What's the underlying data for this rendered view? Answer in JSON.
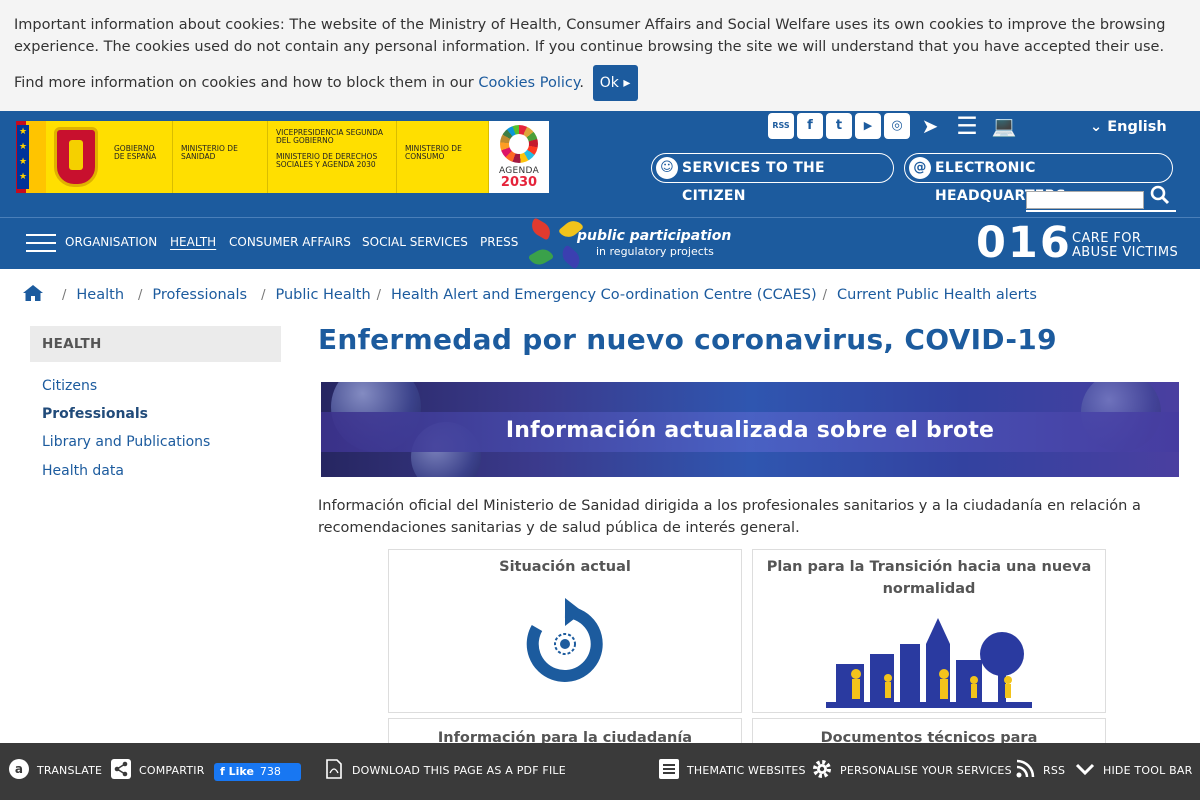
{
  "cookie": {
    "line1": "Important information about cookies: The website of the Ministry of Health, Consumer Affairs and Social Welfare uses its own cookies to improve the browsing experience. The cookies used do not contain any personal information. If you continue browsing the site we will understand that you have accepted their use.",
    "line2_prefix": "Find more information on cookies and how to block them in our ",
    "policy_link": "Cookies Policy",
    "period": ".",
    "ok_label": "Ok"
  },
  "logos": {
    "gobierno": "GOBIERNO DE ESPAÑA",
    "sanidad": "MINISTERIO DE SANIDAD",
    "vice1": "VICEPRESIDENCIA SEGUNDA DEL GOBIERNO",
    "vice2": "MINISTERIO DE DERECHOS SOCIALES Y AGENDA 2030",
    "consumo": "MINISTERIO DE CONSUMO",
    "agenda_word": "AGENDA",
    "agenda_year": "2030"
  },
  "header": {
    "language": "English",
    "services_label": "SERVICES TO THE CITIZEN",
    "sede_label": "ELECTRONIC HEADQUARTERS",
    "search_placeholder": ""
  },
  "social": [
    {
      "icon": "rss-icon",
      "glyph": "RSS"
    },
    {
      "icon": "facebook-icon",
      "glyph": "f"
    },
    {
      "icon": "twitter-icon",
      "glyph": "t"
    },
    {
      "icon": "youtube-icon",
      "glyph": "▶"
    },
    {
      "icon": "instagram-icon",
      "glyph": "◎"
    },
    {
      "icon": "telegram-icon",
      "glyph": "➤"
    },
    {
      "icon": "list-icon",
      "glyph": "☰"
    },
    {
      "icon": "computer-icon",
      "glyph": "💻"
    }
  ],
  "nav": {
    "items": [
      "ORGANISATION",
      "HEALTH",
      "CONSUMER AFFAIRS",
      "SOCIAL SERVICES",
      "PRESS"
    ],
    "pp_title": "public participation",
    "pp_sub": "in regulatory projects",
    "n016": "016",
    "n016_l1": "CARE FOR",
    "n016_l2": "ABUSE VICTIMS"
  },
  "breadcrumb": [
    "Health",
    "Professionals",
    "Public Health",
    "Health Alert and Emergency Co-ordination Centre (CCAES)",
    "Current Public Health alerts"
  ],
  "sidebar": {
    "heading": "HEALTH",
    "items": [
      "Citizens",
      "Professionals",
      "Library and Publications",
      "Health data"
    ]
  },
  "main": {
    "title": "Enfermedad por nuevo coronavirus, COVID-19",
    "banner_text": "Información actualizada sobre el brote",
    "intro": "Información oficial del Ministerio de Sanidad dirigida a los profesionales sanitarios y a la ciudadanía en relación a recomendaciones sanitarias y de salud pública de interés general.",
    "cards": [
      "Situación actual",
      "Plan para la Transición hacia una nueva normalidad",
      "Información para la ciudadanía",
      "Documentos técnicos para profesionales"
    ]
  },
  "toolbar": {
    "translate": "TRANSLATE",
    "share": "COMPARTIR",
    "like": "Like",
    "like_count": "738",
    "pdf": "DOWNLOAD THIS PAGE AS A PDF FILE",
    "thematic": "THEMATIC WEBSITES",
    "personalise": "PERSONALISE YOUR SERVICES",
    "rss": "RSS",
    "hide": "HIDE TOOL BAR"
  },
  "colors": {
    "brand_blue": "#1c5b9e",
    "toolbar_bg": "#3a3a3a",
    "agenda_red": "#e5243b"
  }
}
